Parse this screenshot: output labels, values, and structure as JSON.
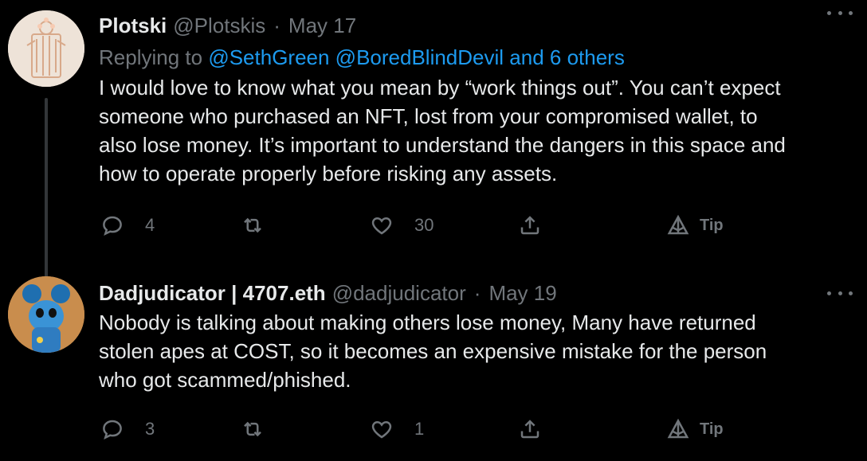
{
  "tweets": [
    {
      "display_name": "Plotski",
      "handle": "@Plotskis",
      "separator": "·",
      "date": "May 17",
      "replying_prefix": "Replying to ",
      "replying_mentions": "@SethGreen @BoredBlindDevil and 6 others",
      "text": "I would love to know what you mean by “work things out”. You can’t expect\nsomeone who purchased an NFT, lost from your compromised wallet, to\nalso lose money.  It’s important to understand the dangers in this space and\nhow to operate properly before risking any assets.",
      "reply_count": "4",
      "retweet_count": "",
      "like_count": "30",
      "tip_label": "Tip"
    },
    {
      "display_name": "Dadjudicator | 4707.eth",
      "handle": "@dadjudicator",
      "separator": "·",
      "date": "May 19",
      "text": "Nobody is talking about making others lose money, Many have returned\nstolen apes at COST, so it becomes an expensive mistake for the person\nwho got scammed/phished.",
      "reply_count": "3",
      "retweet_count": "",
      "like_count": "1",
      "tip_label": "Tip"
    }
  ],
  "colors": {
    "background": "#000000",
    "text_primary": "#e7e9ea",
    "text_secondary": "#71767b",
    "link": "#1d9bf0",
    "thread_line": "#333639"
  },
  "icons": [
    "more-icon",
    "reply-icon",
    "retweet-icon",
    "like-icon",
    "share-icon",
    "tip-icon"
  ]
}
